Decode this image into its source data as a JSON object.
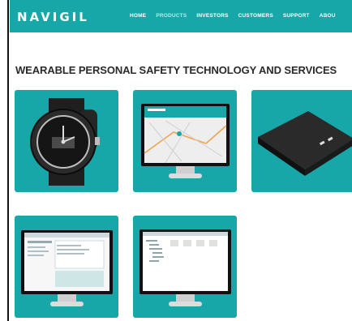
{
  "brand": {
    "logo_text": "NAVIGIL",
    "accent": "#17a7a8"
  },
  "nav": {
    "items": [
      {
        "label": "HOME",
        "active": false
      },
      {
        "label": "PRODUCTS",
        "active": true
      },
      {
        "label": "INVESTORS",
        "active": false
      },
      {
        "label": "CUSTOMERS",
        "active": false
      },
      {
        "label": "SUPPORT",
        "active": false
      },
      {
        "label": "ABOU",
        "active": false
      }
    ]
  },
  "main": {
    "headline": "WEARABLE PERSONAL SAFETY TECHNOLOGY AND SERVICES",
    "products": [
      {
        "icon": "watch-icon"
      },
      {
        "icon": "map-monitor-icon"
      },
      {
        "icon": "device-icon"
      },
      {
        "icon": "dashboard-monitor-icon"
      },
      {
        "icon": "tree-monitor-icon"
      }
    ]
  }
}
